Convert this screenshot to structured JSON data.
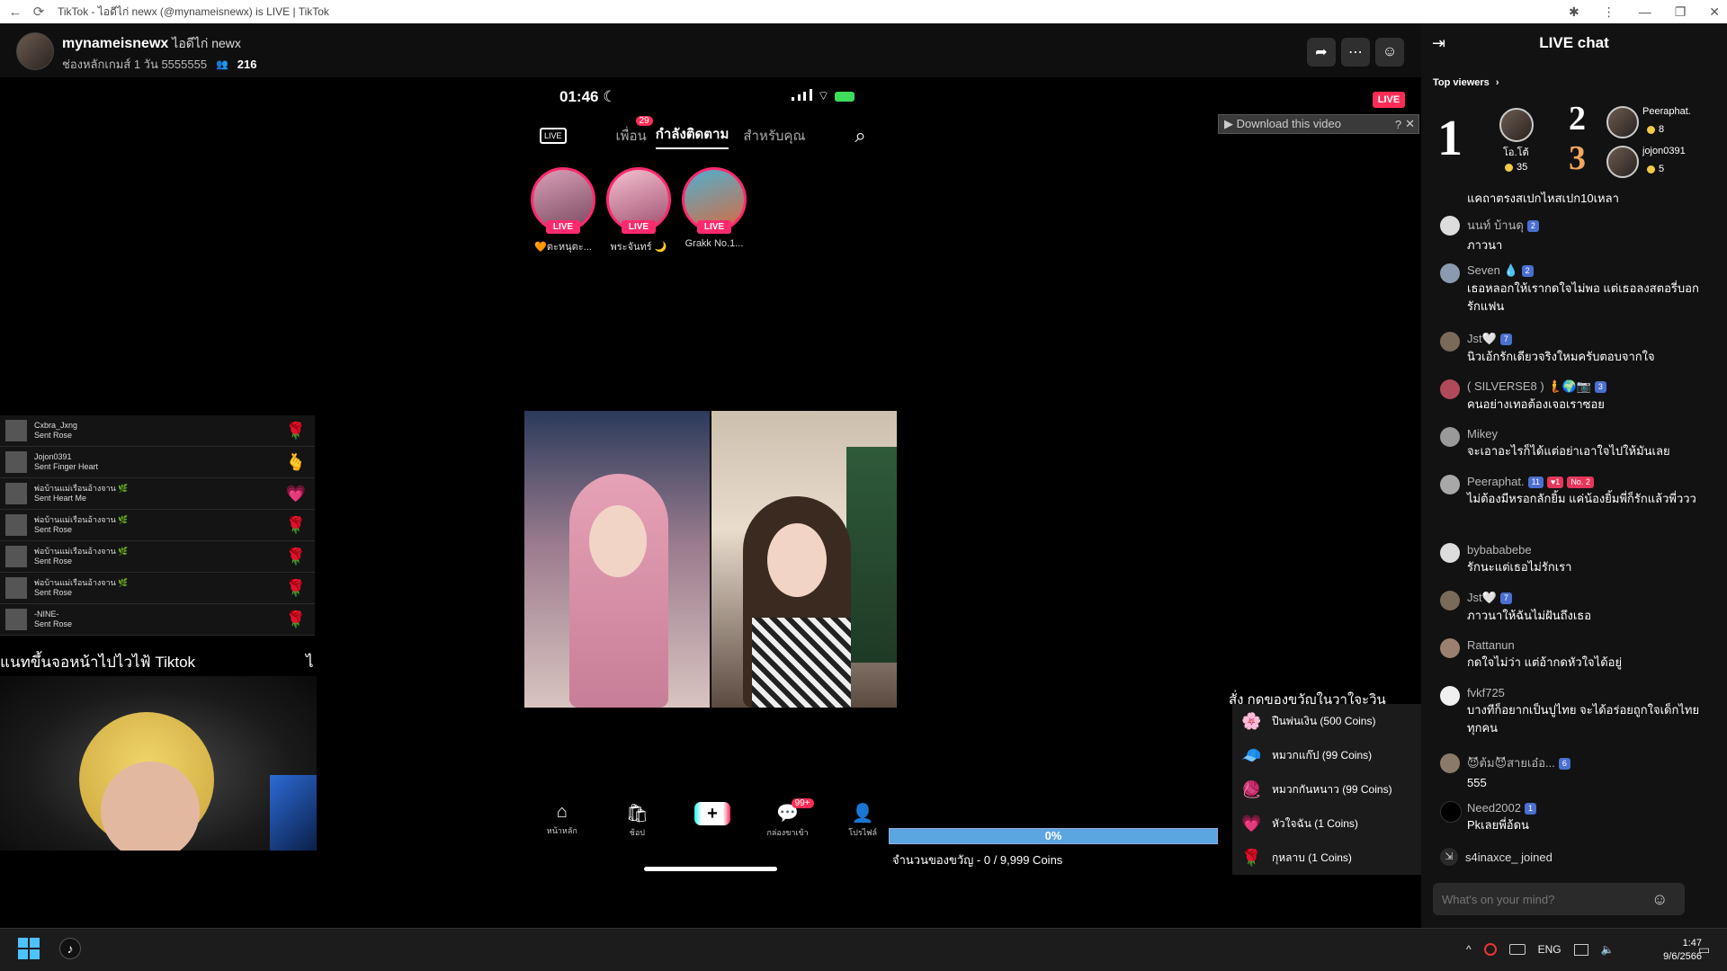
{
  "browser": {
    "title": "TikTok - ไอดีไก่  newx (@mynameisnewx) is LIVE | TikTok",
    "back_icon": "←",
    "reload_icon": "⟳",
    "extensions_icon": "✱",
    "menu_icon": "⋮",
    "minimize_icon": "—",
    "maximize_icon": "❐",
    "close_icon": "✕"
  },
  "host": {
    "username": "mynameisnewx",
    "nickname": "ไอดีไก่  newx",
    "subtitle": "ช่องหลักเกมส์ 1 วัน 5555555",
    "viewer_icon": "👥",
    "viewers": "216"
  },
  "header_actions": {
    "share_icon": "➦",
    "more_icon": "⋯",
    "profile_icon": "☺"
  },
  "phone": {
    "time": "01:46",
    "moon": "☾",
    "live_tab_icon": "LIVE",
    "tabs": [
      {
        "label": "เพื่อน",
        "badge": "29"
      },
      {
        "label": "กำลังติดตาม"
      },
      {
        "label": "สำหรับคุณ"
      }
    ],
    "search_icon": "⌕",
    "stories": [
      {
        "label": "🧡ตะหนุตะ...",
        "live": "LIVE"
      },
      {
        "label": "พระจันทร์ 🌙",
        "live": "LIVE"
      },
      {
        "label": "Grakk No.1...",
        "live": "LIVE"
      }
    ],
    "nav": [
      {
        "icon": "⌂",
        "label": "หน้าหลัก"
      },
      {
        "icon": "🛍",
        "label": "ช้อป"
      },
      {
        "icon": "+",
        "label": ""
      },
      {
        "icon": "💬",
        "label": "กล่องขาเข้า",
        "badge": "99+"
      },
      {
        "icon": "👤",
        "label": "โปรไฟล์"
      }
    ]
  },
  "gift_feed": [
    {
      "user": "Cxbra_Jxng",
      "action": "Sent Rose",
      "gift": "🌹"
    },
    {
      "user": "Jojon0391",
      "action": "Sent Finger Heart",
      "gift": "🫰"
    },
    {
      "user": "พ่อบ้านแม่เรือนอ้างจาน 🌿",
      "action": "Sent Heart Me",
      "gift": "💗"
    },
    {
      "user": "พ่อบ้านแม่เรือนอ้างจาน 🌿",
      "action": "Sent Rose",
      "gift": "🌹"
    },
    {
      "user": "พ่อบ้านแม่เรือนอ้างจาน 🌿",
      "action": "Sent Rose",
      "gift": "🌹"
    },
    {
      "user": "พ่อบ้านแม่เรือนอ้างจาน 🌿",
      "action": "Sent Rose",
      "gift": "🌹"
    },
    {
      "user": "-NINE-",
      "action": "Sent Rose",
      "gift": "🌹"
    }
  ],
  "ticker_left": "แนทขึ้นจอหน้าไปไวไฟ้ Tiktok",
  "ticker_left_end": "ไ",
  "live_badge": "LIVE",
  "download": {
    "label": "▶ Download this video",
    "help": "?",
    "close": "✕"
  },
  "ticker_right": "สั่ง กดของขวัญในวาใจะวิน",
  "gift_menu": [
    {
      "icon": "🌸",
      "label": "ปืนพ่นเงิน (500 Coins)"
    },
    {
      "icon": "🧢",
      "label": "หมวกแก๊ป (99 Coins)"
    },
    {
      "icon": "🧶",
      "label": "หมวกกันหนาว (99 Coins)"
    },
    {
      "icon": "💗",
      "label": "หัวใจฉัน (1 Coins)"
    },
    {
      "icon": "🌹",
      "label": "กุหลาบ (1 Coins)"
    }
  ],
  "progress": {
    "label": "0%",
    "value": 0
  },
  "gift_count": "จำนวนของขวัญ - 0 / 9,999 Coins",
  "chat": {
    "title": "LIVE chat",
    "collapse_icon": "⇥",
    "top_viewers_label": "Top viewers",
    "top_viewers_chevron": "›",
    "top": [
      {
        "rank": "1",
        "name": "โอ.โต้",
        "coins": "35"
      },
      {
        "rank": "2",
        "name": "Peeraphat.",
        "coins": "8"
      },
      {
        "rank": "3",
        "name": "jojon0391",
        "coins": "5"
      }
    ],
    "partial_message": "แคถาตรงสเปกไหสเปก10เหลา",
    "messages": [
      {
        "name": "นนท์ บ้านดุ",
        "badges": [
          "2"
        ],
        "text": "ภาวนา"
      },
      {
        "name": "Seven 💧",
        "badges": [
          "2"
        ],
        "text": "เธอหลอกให้เรากดใจไม่พอ แต่เธอลงสตอรี่บอกรักแฟน"
      },
      {
        "name": "Jst🤍",
        "badges": [
          "7"
        ],
        "text": "นิวเอ้กรักเดียวจริงใหมครับตอบจากใจ"
      },
      {
        "name": "( SILVERSE8 ) 🧜🌍📷",
        "badges": [
          "3"
        ],
        "text": "คนอย่างเทอต้องเจอเราซอย"
      },
      {
        "name": "Mikey",
        "badges": [],
        "text": "จะเอาอะไรก็ได้แต่อย่าเอาใจไปให้มันเลย"
      },
      {
        "name": "Peeraphat.",
        "badges": [
          "11",
          "♥1"
        ],
        "rank_badge": "No. 2",
        "text": "ไม่ต้องมีหรอกลักยิ้ม แค่น้องยิ้มพี่ก็รักแล้วพี่ววว"
      },
      {
        "name": "bybababebe",
        "badges": [],
        "text": "รักนะแต่เธอไม่รักเรา"
      },
      {
        "name": "Jst🤍",
        "badges": [
          "7"
        ],
        "text": "ภาวนาให้ฉันไม่ฝันถึงเธอ"
      },
      {
        "name": "Rattanun",
        "badges": [],
        "text": "กดใจไม่ว่า แต่อ้ากดหัวใจได้อยู่"
      },
      {
        "name": "fvkf725",
        "badges": [],
        "text": "บางทีก็อยากเป็นปูไทย จะได้อร่อยถูกใจเด็กไทยทุกคน"
      },
      {
        "name": "😈ต้ม😈สายเอ๋อ...",
        "badges": [
          "6"
        ],
        "text": "555"
      },
      {
        "name": "Need2002",
        "badges": [
          "1"
        ],
        "text": "Pkเลยพี่อ้ดน"
      }
    ],
    "join_icon": "⇲",
    "joined": "s4inaxce_ joined",
    "input_placeholder": "What's on your mind?",
    "emoji_icon": "☺"
  },
  "taskbar": {
    "tiktok_icon": "♪",
    "tray_chevron": "^",
    "lang": "ENG",
    "time": "1:47",
    "date": "9/6/2566"
  },
  "colors": {
    "live_red": "#fe2c55",
    "badge_blue": "#4a6fd1",
    "coin_gold": "#f6c945",
    "chat_bg": "#121212"
  }
}
